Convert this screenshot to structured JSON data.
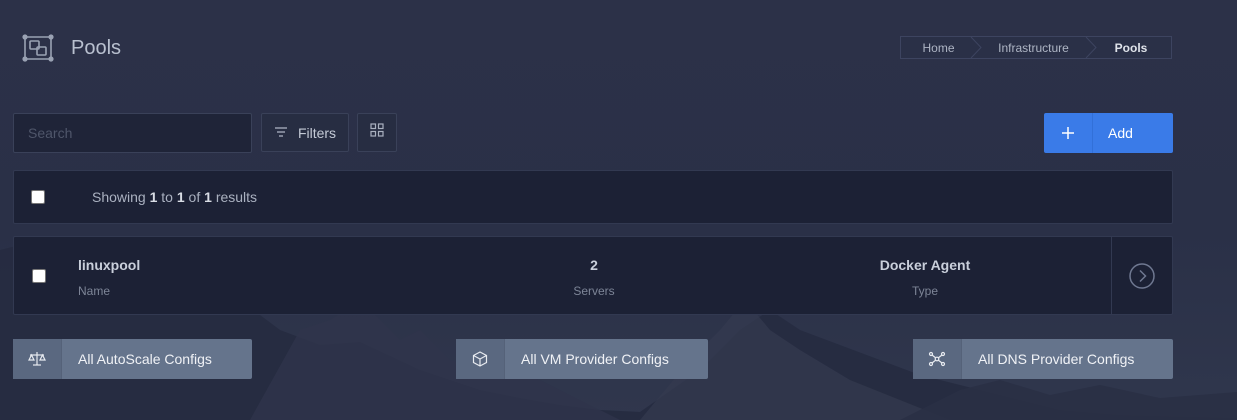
{
  "header": {
    "title": "Pools",
    "icon": "pool-icon"
  },
  "breadcrumb": {
    "items": [
      "Home",
      "Infrastructure",
      "Pools"
    ]
  },
  "toolbar": {
    "search_placeholder": "Search",
    "filters_label": "Filters",
    "add_label": "Add"
  },
  "results": {
    "prefix": "Showing",
    "from": "1",
    "to_word": "to",
    "to": "1",
    "of_word": "of",
    "total": "1",
    "suffix": "results"
  },
  "pools": [
    {
      "name": "linuxpool",
      "name_label": "Name",
      "servers": "2",
      "servers_label": "Servers",
      "type": "Docker Agent",
      "type_label": "Type"
    }
  ],
  "footer_buttons": [
    {
      "label": "All AutoScale Configs",
      "icon": "scale-icon"
    },
    {
      "label": "All VM Provider Configs",
      "icon": "cube-icon"
    },
    {
      "label": "All DNS Provider Configs",
      "icon": "network-icon"
    }
  ],
  "colors": {
    "accent": "#3a7be8",
    "background": "#2c3148",
    "panel": "#1c2135",
    "secondary_button": "#65748c"
  }
}
